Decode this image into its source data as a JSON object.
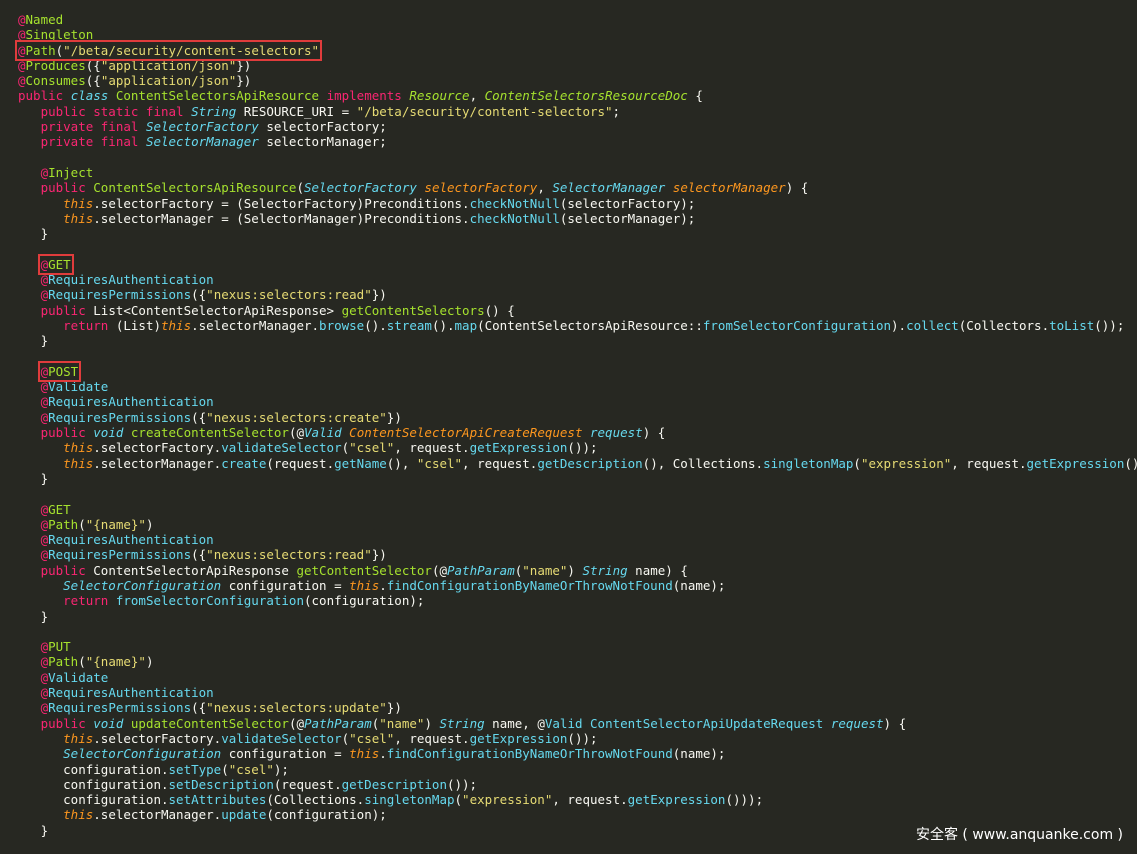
{
  "colors": {
    "background": "#272822",
    "text": "#f8f8f2",
    "annotation_at": "#f92672",
    "annotation_name": "#a6e22e",
    "keyword": "#f92672",
    "type_italic": "#66d9ef",
    "string": "#e6db74",
    "method": "#a6e22e",
    "this_keyword": "#fd971f",
    "param_italic": "#fd971f",
    "highlight_box": "#e03c3c",
    "watermark": "#ffffff"
  },
  "code": {
    "lines": [
      [
        {
          "t": "@",
          "c": "p"
        },
        {
          "t": "Named",
          "c": "g"
        }
      ],
      [
        {
          "t": "@",
          "c": "p"
        },
        {
          "t": "Singleton",
          "c": "g"
        }
      ],
      [
        {
          "t": "@",
          "c": "p",
          "hl": 1
        },
        {
          "t": "Path",
          "c": "g",
          "hl": 1
        },
        {
          "t": "(",
          "c": "w",
          "hl": 1
        },
        {
          "t": "\"/beta/security/content-selectors\"",
          "c": "y",
          "hl": 1
        }
      ],
      [
        {
          "t": "@",
          "c": "p"
        },
        {
          "t": "Produces",
          "c": "g"
        },
        {
          "t": "({",
          "c": "w"
        },
        {
          "t": "\"application/json\"",
          "c": "y"
        },
        {
          "t": "})",
          "c": "w"
        }
      ],
      [
        {
          "t": "@",
          "c": "p"
        },
        {
          "t": "Consumes",
          "c": "g"
        },
        {
          "t": "({",
          "c": "w"
        },
        {
          "t": "\"application/json\"",
          "c": "y"
        },
        {
          "t": "})",
          "c": "w"
        }
      ],
      [
        {
          "t": "public ",
          "c": "p"
        },
        {
          "t": "class ",
          "c": "bi"
        },
        {
          "t": "ContentSelectorsApiResource ",
          "c": "g"
        },
        {
          "t": "implements ",
          "c": "p"
        },
        {
          "t": "Resource",
          "c": "gi"
        },
        {
          "t": ", ",
          "c": "w"
        },
        {
          "t": "ContentSelectorsResourceDoc",
          "c": "gi"
        },
        {
          "t": " {",
          "c": "w"
        }
      ],
      [
        {
          "t": "   public static final ",
          "c": "p"
        },
        {
          "t": "String",
          "c": "bi"
        },
        {
          "t": " RESOURCE_URI = ",
          "c": "w"
        },
        {
          "t": "\"/beta/security/content-selectors\"",
          "c": "y"
        },
        {
          "t": ";",
          "c": "w"
        }
      ],
      [
        {
          "t": "   private final ",
          "c": "p"
        },
        {
          "t": "SelectorFactory",
          "c": "bi"
        },
        {
          "t": " selectorFactory;",
          "c": "w"
        }
      ],
      [
        {
          "t": "   private final ",
          "c": "p"
        },
        {
          "t": "SelectorManager",
          "c": "bi"
        },
        {
          "t": " selectorManager;",
          "c": "w"
        }
      ],
      [
        {
          "t": "",
          "c": "w"
        }
      ],
      [
        {
          "t": "   @",
          "c": "p"
        },
        {
          "t": "Inject",
          "c": "g"
        }
      ],
      [
        {
          "t": "   public ",
          "c": "p"
        },
        {
          "t": "ContentSelectorsApiResource",
          "c": "g"
        },
        {
          "t": "(",
          "c": "w"
        },
        {
          "t": "SelectorFactory",
          "c": "bi"
        },
        {
          "t": " ",
          "c": "w"
        },
        {
          "t": "selectorFactory",
          "c": "oi"
        },
        {
          "t": ", ",
          "c": "w"
        },
        {
          "t": "SelectorManager",
          "c": "bi"
        },
        {
          "t": " ",
          "c": "w"
        },
        {
          "t": "selectorManager",
          "c": "oi"
        },
        {
          "t": ") {",
          "c": "w"
        }
      ],
      [
        {
          "t": "      ",
          "c": "w"
        },
        {
          "t": "this",
          "c": "oi"
        },
        {
          "t": ".selectorFactory = (SelectorFactory)Preconditions.",
          "c": "w"
        },
        {
          "t": "checkNotNull",
          "c": "b"
        },
        {
          "t": "(selectorFactory);",
          "c": "w"
        }
      ],
      [
        {
          "t": "      ",
          "c": "w"
        },
        {
          "t": "this",
          "c": "oi"
        },
        {
          "t": ".selectorManager = (SelectorManager)Preconditions.",
          "c": "w"
        },
        {
          "t": "checkNotNull",
          "c": "b"
        },
        {
          "t": "(selectorManager);",
          "c": "w"
        }
      ],
      [
        {
          "t": "   }",
          "c": "w"
        }
      ],
      [
        {
          "t": "",
          "c": "w"
        }
      ],
      [
        {
          "t": "   ",
          "c": "w"
        },
        {
          "t": "@",
          "c": "p",
          "hl": 1
        },
        {
          "t": "GET",
          "c": "g",
          "hl": 1
        }
      ],
      [
        {
          "t": "   @",
          "c": "p"
        },
        {
          "t": "RequiresAuthentication",
          "c": "b"
        }
      ],
      [
        {
          "t": "   @",
          "c": "p"
        },
        {
          "t": "RequiresPermissions",
          "c": "b"
        },
        {
          "t": "({",
          "c": "w"
        },
        {
          "t": "\"nexus:selectors:read\"",
          "c": "y"
        },
        {
          "t": "})",
          "c": "w"
        }
      ],
      [
        {
          "t": "   public ",
          "c": "p"
        },
        {
          "t": "List<ContentSelectorApiResponse> ",
          "c": "w"
        },
        {
          "t": "getContentSelectors",
          "c": "g"
        },
        {
          "t": "() {",
          "c": "w"
        }
      ],
      [
        {
          "t": "      return ",
          "c": "p"
        },
        {
          "t": "(List)",
          "c": "w"
        },
        {
          "t": "this",
          "c": "oi"
        },
        {
          "t": ".selectorManager.",
          "c": "w"
        },
        {
          "t": "browse",
          "c": "b"
        },
        {
          "t": "().",
          "c": "w"
        },
        {
          "t": "stream",
          "c": "b"
        },
        {
          "t": "().",
          "c": "w"
        },
        {
          "t": "map",
          "c": "b"
        },
        {
          "t": "(ContentSelectorsApiResource::",
          "c": "w"
        },
        {
          "t": "fromSelectorConfiguration",
          "c": "b"
        },
        {
          "t": ").",
          "c": "w"
        },
        {
          "t": "collect",
          "c": "b"
        },
        {
          "t": "(Collectors.",
          "c": "w"
        },
        {
          "t": "toList",
          "c": "b"
        },
        {
          "t": "());",
          "c": "w"
        }
      ],
      [
        {
          "t": "   }",
          "c": "w"
        }
      ],
      [
        {
          "t": "",
          "c": "w"
        }
      ],
      [
        {
          "t": "   ",
          "c": "w"
        },
        {
          "t": "@",
          "c": "p",
          "hl": 1
        },
        {
          "t": "POST",
          "c": "g",
          "hl": 1
        }
      ],
      [
        {
          "t": "   @",
          "c": "p"
        },
        {
          "t": "Validate",
          "c": "b"
        }
      ],
      [
        {
          "t": "   @",
          "c": "p"
        },
        {
          "t": "RequiresAuthentication",
          "c": "b"
        }
      ],
      [
        {
          "t": "   @",
          "c": "p"
        },
        {
          "t": "RequiresPermissions",
          "c": "b"
        },
        {
          "t": "({",
          "c": "w"
        },
        {
          "t": "\"nexus:selectors:create\"",
          "c": "y"
        },
        {
          "t": "})",
          "c": "w"
        }
      ],
      [
        {
          "t": "   public ",
          "c": "p"
        },
        {
          "t": "void ",
          "c": "bi"
        },
        {
          "t": "createContentSelector",
          "c": "g"
        },
        {
          "t": "(@",
          "c": "w"
        },
        {
          "t": "Valid ",
          "c": "bi"
        },
        {
          "t": "ContentSelectorApiCreateRequest",
          "c": "oi"
        },
        {
          "t": " ",
          "c": "w"
        },
        {
          "t": "request",
          "c": "bi"
        },
        {
          "t": ") {",
          "c": "w"
        }
      ],
      [
        {
          "t": "      ",
          "c": "w"
        },
        {
          "t": "this",
          "c": "oi"
        },
        {
          "t": ".selectorFactory.",
          "c": "w"
        },
        {
          "t": "validateSelector",
          "c": "b"
        },
        {
          "t": "(",
          "c": "w"
        },
        {
          "t": "\"csel\"",
          "c": "y"
        },
        {
          "t": ", request.",
          "c": "w"
        },
        {
          "t": "getExpression",
          "c": "b"
        },
        {
          "t": "());",
          "c": "w"
        }
      ],
      [
        {
          "t": "      ",
          "c": "w"
        },
        {
          "t": "this",
          "c": "oi"
        },
        {
          "t": ".selectorManager.",
          "c": "w"
        },
        {
          "t": "create",
          "c": "b"
        },
        {
          "t": "(request.",
          "c": "w"
        },
        {
          "t": "getName",
          "c": "b"
        },
        {
          "t": "(), ",
          "c": "w"
        },
        {
          "t": "\"csel\"",
          "c": "y"
        },
        {
          "t": ", request.",
          "c": "w"
        },
        {
          "t": "getDescription",
          "c": "b"
        },
        {
          "t": "(), Collections.",
          "c": "w"
        },
        {
          "t": "singletonMap",
          "c": "b"
        },
        {
          "t": "(",
          "c": "w"
        },
        {
          "t": "\"expression\"",
          "c": "y"
        },
        {
          "t": ", request.",
          "c": "w"
        },
        {
          "t": "getExpression",
          "c": "b"
        },
        {
          "t": "()));",
          "c": "w"
        }
      ],
      [
        {
          "t": "   }",
          "c": "w"
        }
      ],
      [
        {
          "t": "",
          "c": "w"
        }
      ],
      [
        {
          "t": "   @",
          "c": "p"
        },
        {
          "t": "GET",
          "c": "g"
        }
      ],
      [
        {
          "t": "   @",
          "c": "p"
        },
        {
          "t": "Path",
          "c": "g"
        },
        {
          "t": "(",
          "c": "w"
        },
        {
          "t": "\"{name}\"",
          "c": "y"
        },
        {
          "t": ")",
          "c": "w"
        }
      ],
      [
        {
          "t": "   @",
          "c": "p"
        },
        {
          "t": "RequiresAuthentication",
          "c": "b"
        }
      ],
      [
        {
          "t": "   @",
          "c": "p"
        },
        {
          "t": "RequiresPermissions",
          "c": "b"
        },
        {
          "t": "({",
          "c": "w"
        },
        {
          "t": "\"nexus:selectors:read\"",
          "c": "y"
        },
        {
          "t": "})",
          "c": "w"
        }
      ],
      [
        {
          "t": "   public ",
          "c": "p"
        },
        {
          "t": "ContentSelectorApiResponse ",
          "c": "w"
        },
        {
          "t": "getContentSelector",
          "c": "g"
        },
        {
          "t": "(@",
          "c": "w"
        },
        {
          "t": "PathParam",
          "c": "bi"
        },
        {
          "t": "(",
          "c": "w"
        },
        {
          "t": "\"name\"",
          "c": "y"
        },
        {
          "t": ") ",
          "c": "w"
        },
        {
          "t": "String",
          "c": "bi"
        },
        {
          "t": " name) {",
          "c": "w"
        }
      ],
      [
        {
          "t": "      ",
          "c": "w"
        },
        {
          "t": "SelectorConfiguration",
          "c": "bi"
        },
        {
          "t": " configuration = ",
          "c": "w"
        },
        {
          "t": "this",
          "c": "oi"
        },
        {
          "t": ".",
          "c": "w"
        },
        {
          "t": "findConfigurationByNameOrThrowNotFound",
          "c": "b"
        },
        {
          "t": "(name);",
          "c": "w"
        }
      ],
      [
        {
          "t": "      return ",
          "c": "p"
        },
        {
          "t": "fromSelectorConfiguration",
          "c": "b"
        },
        {
          "t": "(configuration);",
          "c": "w"
        }
      ],
      [
        {
          "t": "   }",
          "c": "w"
        }
      ],
      [
        {
          "t": "",
          "c": "w"
        }
      ],
      [
        {
          "t": "   @",
          "c": "p"
        },
        {
          "t": "PUT",
          "c": "g"
        }
      ],
      [
        {
          "t": "   @",
          "c": "p"
        },
        {
          "t": "Path",
          "c": "g"
        },
        {
          "t": "(",
          "c": "w"
        },
        {
          "t": "\"{name}\"",
          "c": "y"
        },
        {
          "t": ")",
          "c": "w"
        }
      ],
      [
        {
          "t": "   @",
          "c": "p"
        },
        {
          "t": "Validate",
          "c": "b"
        }
      ],
      [
        {
          "t": "   @",
          "c": "p"
        },
        {
          "t": "RequiresAuthentication",
          "c": "b"
        }
      ],
      [
        {
          "t": "   @",
          "c": "p"
        },
        {
          "t": "RequiresPermissions",
          "c": "b"
        },
        {
          "t": "({",
          "c": "w"
        },
        {
          "t": "\"nexus:selectors:update\"",
          "c": "y"
        },
        {
          "t": "})",
          "c": "w"
        }
      ],
      [
        {
          "t": "   public ",
          "c": "p"
        },
        {
          "t": "void ",
          "c": "bi"
        },
        {
          "t": "updateContentSelector",
          "c": "g"
        },
        {
          "t": "(@",
          "c": "w"
        },
        {
          "t": "PathParam",
          "c": "bi"
        },
        {
          "t": "(",
          "c": "w"
        },
        {
          "t": "\"name\"",
          "c": "y"
        },
        {
          "t": ") ",
          "c": "w"
        },
        {
          "t": "String",
          "c": "bi"
        },
        {
          "t": " name, @",
          "c": "w"
        },
        {
          "t": "Valid ",
          "c": "b"
        },
        {
          "t": "ContentSelectorApiUpdateRequest ",
          "c": "b"
        },
        {
          "t": "request",
          "c": "bi"
        },
        {
          "t": ") {",
          "c": "w"
        }
      ],
      [
        {
          "t": "      ",
          "c": "w"
        },
        {
          "t": "this",
          "c": "oi"
        },
        {
          "t": ".selectorFactory.",
          "c": "w"
        },
        {
          "t": "validateSelector",
          "c": "b"
        },
        {
          "t": "(",
          "c": "w"
        },
        {
          "t": "\"csel\"",
          "c": "y"
        },
        {
          "t": ", request.",
          "c": "w"
        },
        {
          "t": "getExpression",
          "c": "b"
        },
        {
          "t": "());",
          "c": "w"
        }
      ],
      [
        {
          "t": "      ",
          "c": "w"
        },
        {
          "t": "SelectorConfiguration",
          "c": "bi"
        },
        {
          "t": " configuration = ",
          "c": "w"
        },
        {
          "t": "this",
          "c": "oi"
        },
        {
          "t": ".",
          "c": "w"
        },
        {
          "t": "findConfigurationByNameOrThrowNotFound",
          "c": "b"
        },
        {
          "t": "(name);",
          "c": "w"
        }
      ],
      [
        {
          "t": "      configuration.",
          "c": "w"
        },
        {
          "t": "setType",
          "c": "b"
        },
        {
          "t": "(",
          "c": "w"
        },
        {
          "t": "\"csel\"",
          "c": "y"
        },
        {
          "t": ");",
          "c": "w"
        }
      ],
      [
        {
          "t": "      configuration.",
          "c": "w"
        },
        {
          "t": "setDescription",
          "c": "b"
        },
        {
          "t": "(request.",
          "c": "w"
        },
        {
          "t": "getDescription",
          "c": "b"
        },
        {
          "t": "());",
          "c": "w"
        }
      ],
      [
        {
          "t": "      configuration.",
          "c": "w"
        },
        {
          "t": "setAttributes",
          "c": "b"
        },
        {
          "t": "(Collections.",
          "c": "w"
        },
        {
          "t": "singletonMap",
          "c": "b"
        },
        {
          "t": "(",
          "c": "w"
        },
        {
          "t": "\"expression\"",
          "c": "y"
        },
        {
          "t": ", request.",
          "c": "w"
        },
        {
          "t": "getExpression",
          "c": "b"
        },
        {
          "t": "()));",
          "c": "w"
        }
      ],
      [
        {
          "t": "      ",
          "c": "w"
        },
        {
          "t": "this",
          "c": "oi"
        },
        {
          "t": ".selectorManager.",
          "c": "w"
        },
        {
          "t": "update",
          "c": "b"
        },
        {
          "t": "(configuration);",
          "c": "w"
        }
      ],
      [
        {
          "t": "   }",
          "c": "w"
        }
      ]
    ]
  },
  "watermark": {
    "text": "安全客 ( www.anquanke.com )"
  }
}
